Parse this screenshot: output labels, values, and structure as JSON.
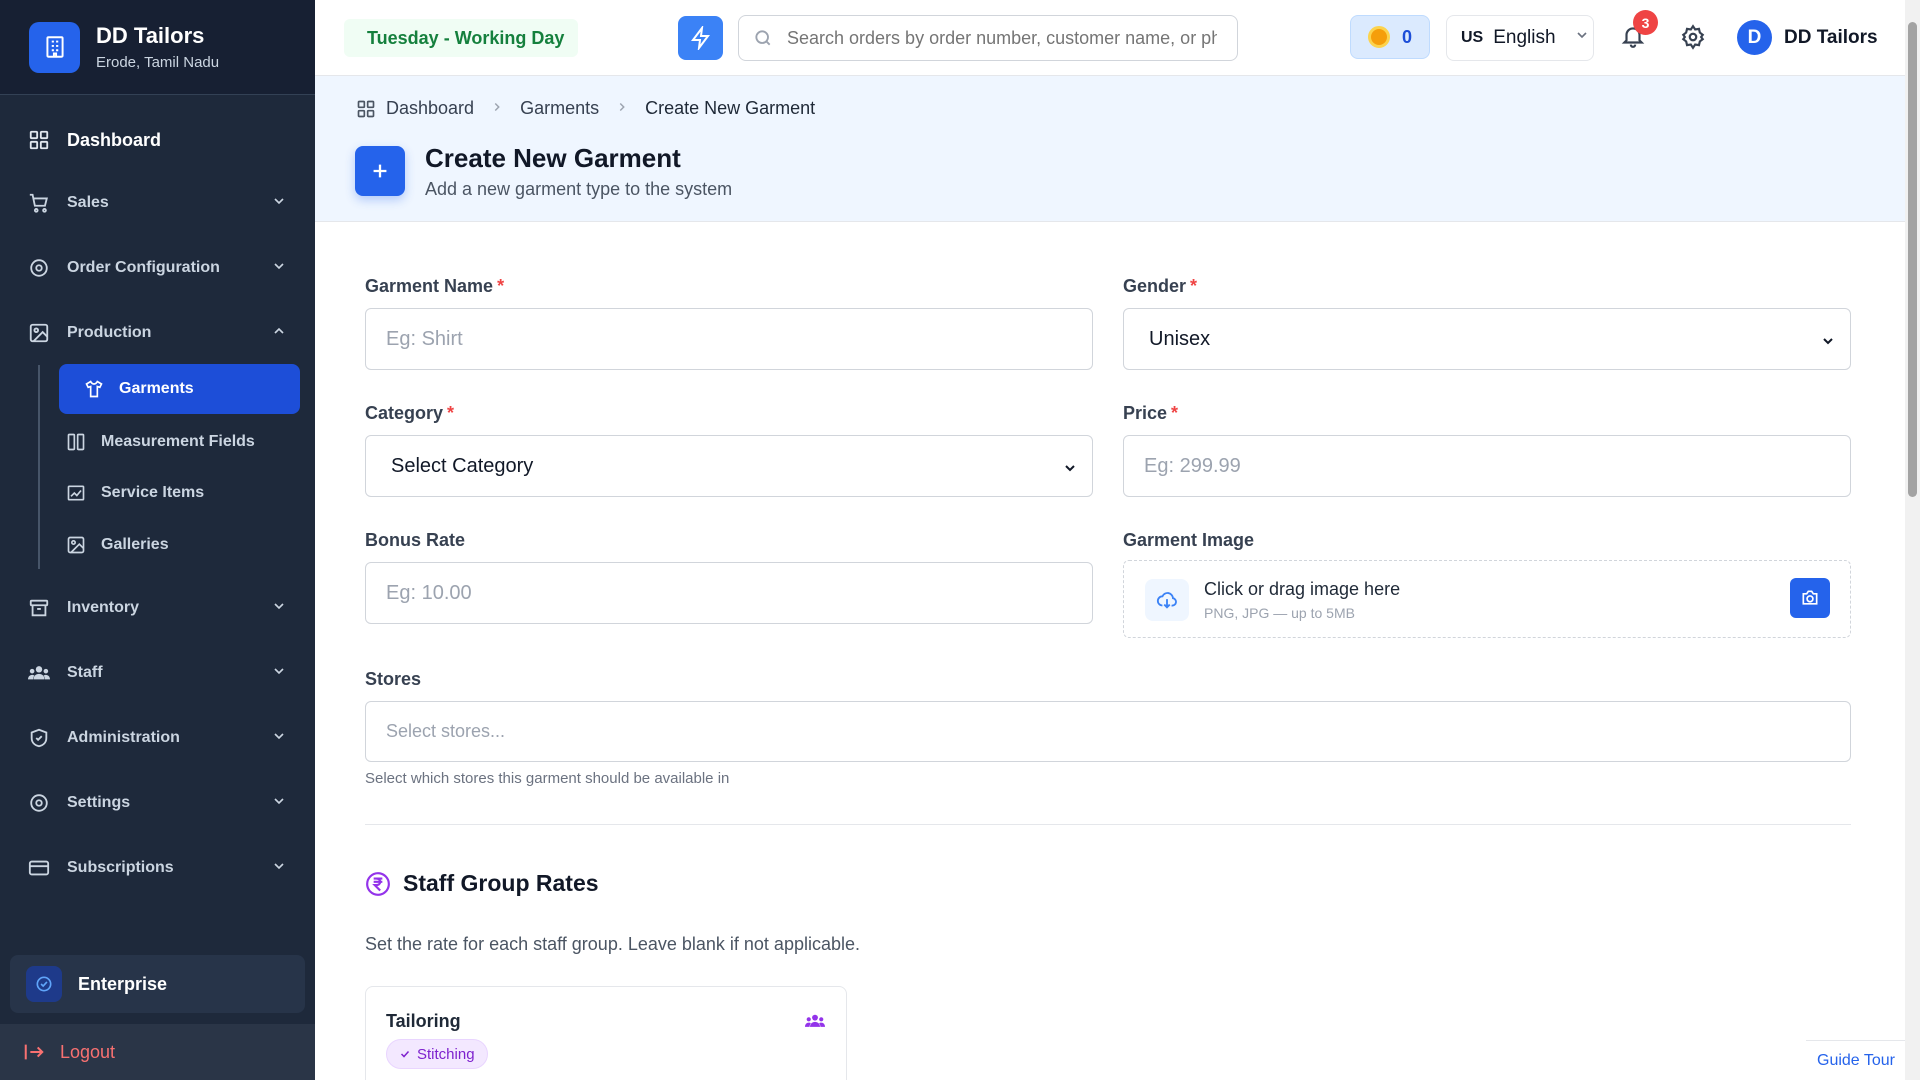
{
  "brand": {
    "name": "DD Tailors",
    "location": "Erode, Tamil Nadu"
  },
  "sidebar": {
    "items": [
      {
        "label": "Dashboard",
        "icon": "dashboard-grid-icon"
      },
      {
        "label": "Sales",
        "icon": "cart-icon"
      },
      {
        "label": "Order Configuration",
        "icon": "gear-icon"
      },
      {
        "label": "Production",
        "icon": "image-icon",
        "expanded": true
      },
      {
        "label": "Inventory",
        "icon": "archive-icon"
      },
      {
        "label": "Staff",
        "icon": "users-icon"
      },
      {
        "label": "Administration",
        "icon": "shield-icon"
      },
      {
        "label": "Settings",
        "icon": "gear-icon"
      },
      {
        "label": "Subscriptions",
        "icon": "card-icon"
      }
    ],
    "production_sub": [
      {
        "label": "Garments",
        "active": true
      },
      {
        "label": "Measurement Fields"
      },
      {
        "label": "Service Items"
      },
      {
        "label": "Galleries"
      }
    ],
    "plan": "Enterprise",
    "logout": "Logout"
  },
  "topbar": {
    "day_status": "Tuesday - Working Day",
    "search_placeholder": "Search orders by order number, customer name, or phone",
    "coins": "0",
    "lang_code": "US",
    "language": "English",
    "notifications": "3",
    "user_initial": "D",
    "user_name": "DD Tailors"
  },
  "breadcrumb": [
    "Dashboard",
    "Garments",
    "Create New Garment"
  ],
  "page": {
    "title": "Create New Garment",
    "subtitle": "Add a new garment type to the system"
  },
  "form": {
    "garment_name": {
      "label": "Garment Name",
      "placeholder": "Eg: Shirt"
    },
    "gender": {
      "label": "Gender",
      "value": "Unisex"
    },
    "category": {
      "label": "Category",
      "value": "Select Category"
    },
    "price": {
      "label": "Price",
      "placeholder": "Eg: 299.99"
    },
    "bonus_rate": {
      "label": "Bonus Rate",
      "placeholder": "Eg: 10.00"
    },
    "garment_image": {
      "label": "Garment Image",
      "title": "Click or drag image here",
      "hint": "PNG, JPG — up to 5MB"
    },
    "stores": {
      "label": "Stores",
      "placeholder": "Select stores...",
      "help": "Select which stores this garment should be available in"
    }
  },
  "staff_rates": {
    "title": "Staff Group Rates",
    "subtitle": "Set the rate for each staff group. Leave blank if not applicable.",
    "cards": [
      {
        "name": "Tailoring",
        "tag": "Stitching"
      }
    ]
  },
  "guide_tour": "Guide Tour",
  "colors": {
    "primary": "#2563eb",
    "sidebar": "#1e293b",
    "danger": "#ef4444",
    "success": "#15803d",
    "purple": "#9333ea"
  }
}
